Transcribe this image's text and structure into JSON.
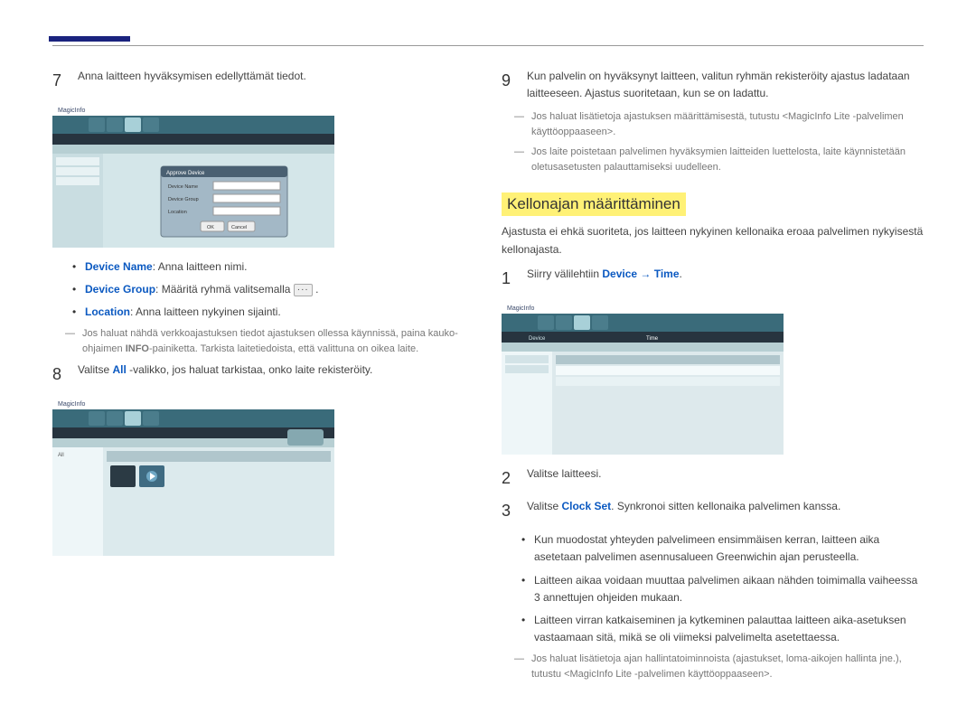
{
  "left": {
    "step7": {
      "num": "7",
      "text": "Anna laitteen hyväksymisen edellyttämät tiedot."
    },
    "bullets": {
      "b1_label": "Device Name",
      "b1_text": ": Anna laitteen nimi.",
      "b2_label": "Device Group",
      "b2_text": ": Määritä ryhmä valitsemalla ",
      "b2_suffix": " .",
      "b3_label": "Location",
      "b3_text": ": Anna laitteen nykyinen sijainti."
    },
    "dash1_pre": "Jos haluat nähdä verkkoajastuksen tiedot ajastuksen ollessa käynnissä, paina kauko-ohjaimen ",
    "dash1_bold": "INFO",
    "dash1_post": "-painiketta. Tarkista laitetiedoista, että valittuna on oikea laite.",
    "step8": {
      "num": "8",
      "pre": "Valitse ",
      "bold": "All",
      "post": " -valikko, jos haluat tarkistaa, onko laite rekisteröity."
    }
  },
  "right": {
    "step9": {
      "num": "9",
      "text": "Kun palvelin on hyväksynyt laitteen, valitun ryhmän rekisteröity ajastus ladataan laitteeseen. Ajastus suoritetaan, kun se on ladattu."
    },
    "dash_r1": "Jos haluat lisätietoja ajastuksen määrittämisestä, tutustu <MagicInfo Lite -palvelimen käyttöoppaaseen>.",
    "dash_r2": "Jos laite poistetaan palvelimen hyväksymien laitteiden luettelosta, laite käynnistetään oletusasetusten palauttamiseksi uudelleen.",
    "heading": "Kellonajan määrittäminen",
    "intro": "Ajastusta ei ehkä suoriteta, jos laitteen nykyinen kellonaika eroaa palvelimen nykyisestä kellonajasta.",
    "step1": {
      "num": "1",
      "pre": "Siirry välilehtiin ",
      "bold": "Device → Time",
      "post": "."
    },
    "step2": {
      "num": "2",
      "text": "Valitse laitteesi."
    },
    "step3": {
      "num": "3",
      "pre": "Valitse ",
      "bold": "Clock Set",
      "post": ". Synkronoi sitten kellonaika palvelimen kanssa."
    },
    "bullets_r": {
      "b1": "Kun muodostat yhteyden palvelimeen ensimmäisen kerran, laitteen aika asetetaan palvelimen asennusalueen Greenwichin ajan perusteella.",
      "b2": "Laitteen aikaa voidaan muuttaa palvelimen aikaan nähden toimimalla vaiheessa 3 annettujen ohjeiden mukaan.",
      "b3": "Laitteen virran katkaiseminen ja kytkeminen palauttaa laitteen aika-asetuksen vastaamaan sitä, mikä se oli viimeksi palvelimelta asetettaessa."
    },
    "dash_r3": "Jos haluat lisätietoja ajan hallintatoiminnoista (ajastukset, loma-aikojen hallinta jne.), tutustu <MagicInfo Lite -palvelimen käyttöoppaaseen>."
  },
  "svg": {
    "logo": "MagicInfo",
    "approve_title": "Approve Device",
    "approve_f1": "Device Name",
    "approve_f2": "Device Group",
    "approve_f3": "Location",
    "btn_ok": "OK",
    "btn_cancel": "Cancel",
    "tab_device": "Device",
    "tab_time": "Time"
  }
}
